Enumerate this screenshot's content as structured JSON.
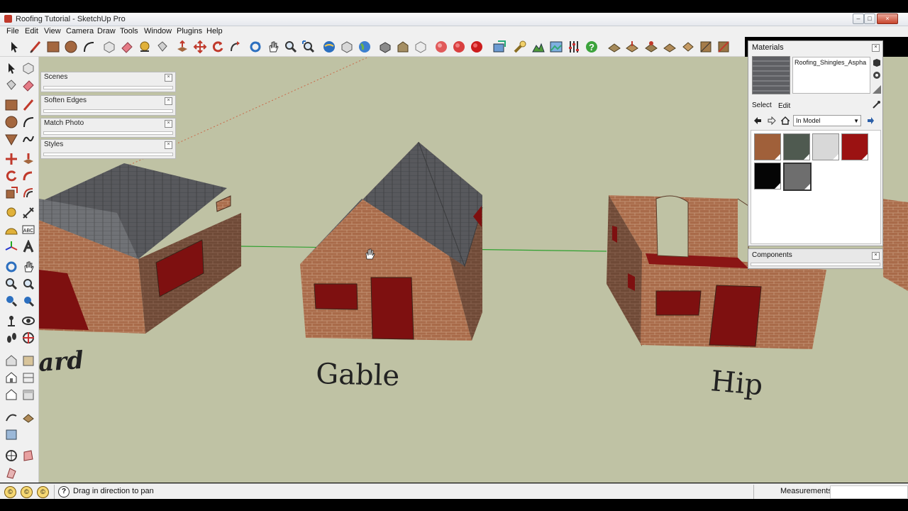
{
  "window": {
    "title": "Roofing Tutorial - SketchUp Pro",
    "controls": [
      "–",
      "□",
      "×"
    ]
  },
  "menu": [
    "File",
    "Edit",
    "View",
    "Camera",
    "Draw",
    "Tools",
    "Window",
    "Plugins",
    "Help"
  ],
  "trays": [
    {
      "title": "Scenes"
    },
    {
      "title": "Soften Edges"
    },
    {
      "title": "Match Photo"
    },
    {
      "title": "Styles"
    }
  ],
  "materials": {
    "title": "Materials",
    "current_name": "Roofing_Shingles_Aspha",
    "tabs": [
      "Select",
      "Edit"
    ],
    "library": "In Model",
    "swatches": [
      {
        "name": "brick-light",
        "color": "#a0603a"
      },
      {
        "name": "green-stone",
        "color": "#4f5a50"
      },
      {
        "name": "siding-grey",
        "color": "#d8d8d8"
      },
      {
        "name": "dark-red",
        "color": "#9b1212"
      },
      {
        "name": "black",
        "color": "#050505"
      },
      {
        "name": "roofing-shingles",
        "color": "#6e6e6e"
      }
    ]
  },
  "components": {
    "title": "Components"
  },
  "scene_labels": {
    "left": "ard",
    "center": "Gable",
    "right": "Hip"
  },
  "status": {
    "hint": "Drag in direction to pan",
    "measurements_label": "Measurements",
    "measurements_value": ""
  },
  "colors": {
    "ground": "#bfc2a4",
    "brick": "#a96b4a",
    "roof": "#5a5a5c",
    "door": "#7e1010",
    "axis_green": "#2fa02f"
  }
}
